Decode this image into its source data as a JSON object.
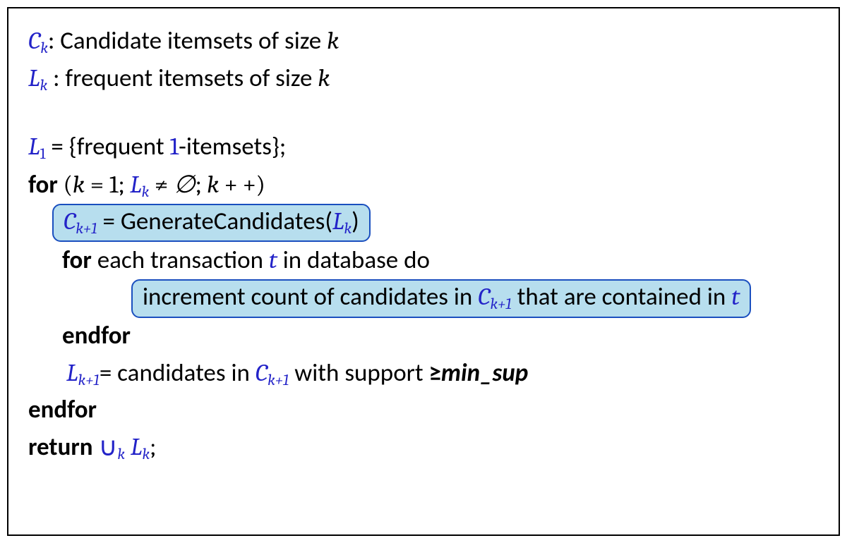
{
  "colors": {
    "var_blue": "#2323c8",
    "highlight_fill": "#b7deee",
    "highlight_border": "#1a4fbf"
  },
  "def1": {
    "sym": "C",
    "sub": "k",
    "colon": ": ",
    "text1": "Candidate itemsets of size ",
    "tail": "k"
  },
  "def2": {
    "sym": "L",
    "sub": "k",
    "colon": " : ",
    "text1": "frequent itemsets of size ",
    "tail": "k"
  },
  "init": {
    "sym": "L",
    "sub": "1",
    "eq": " = ",
    "open": "{frequent ",
    "one": "1",
    "close": "-itemsets};"
  },
  "forloop": {
    "kw": "for",
    "open": " (",
    "k": "k",
    "eq": " = ",
    "one": "1",
    "semi1": "; ",
    "L": "L",
    "Lsub": "k",
    "neq": " ≠ ",
    "empty": "∅",
    "semi2": "; ",
    "k2": "k",
    "inc": " + +",
    "close": ")"
  },
  "gen": {
    "C": "C",
    "Csub": "k+1",
    "eq": " = ",
    "fn": "GenerateCandidates(",
    "L": "L",
    "Lsub": "k",
    "close": ")"
  },
  "innerfor": {
    "kw": "for",
    "text1": " each transaction ",
    "t": "t",
    "text2": " in database do"
  },
  "increment": {
    "pre": "increment count of candidates in ",
    "C": "C",
    "Csub": "k+1",
    "mid": " that are contained in ",
    "t": "t"
  },
  "endfor1": "endfor",
  "filter": {
    "L": "L",
    "Lsub": "k+1",
    "eq": "= ",
    "text1": "candidates in ",
    "C": "C",
    "Csub": "k+1",
    "text2": " with support ",
    "geq": "≥",
    "min": "min_sup"
  },
  "endfor2": "endfor",
  "ret": {
    "kw": "return ",
    "cup": "∪",
    "cupsub": "k",
    "space": " ",
    "L": "L",
    "Lsub": "k",
    "semi": ";"
  }
}
